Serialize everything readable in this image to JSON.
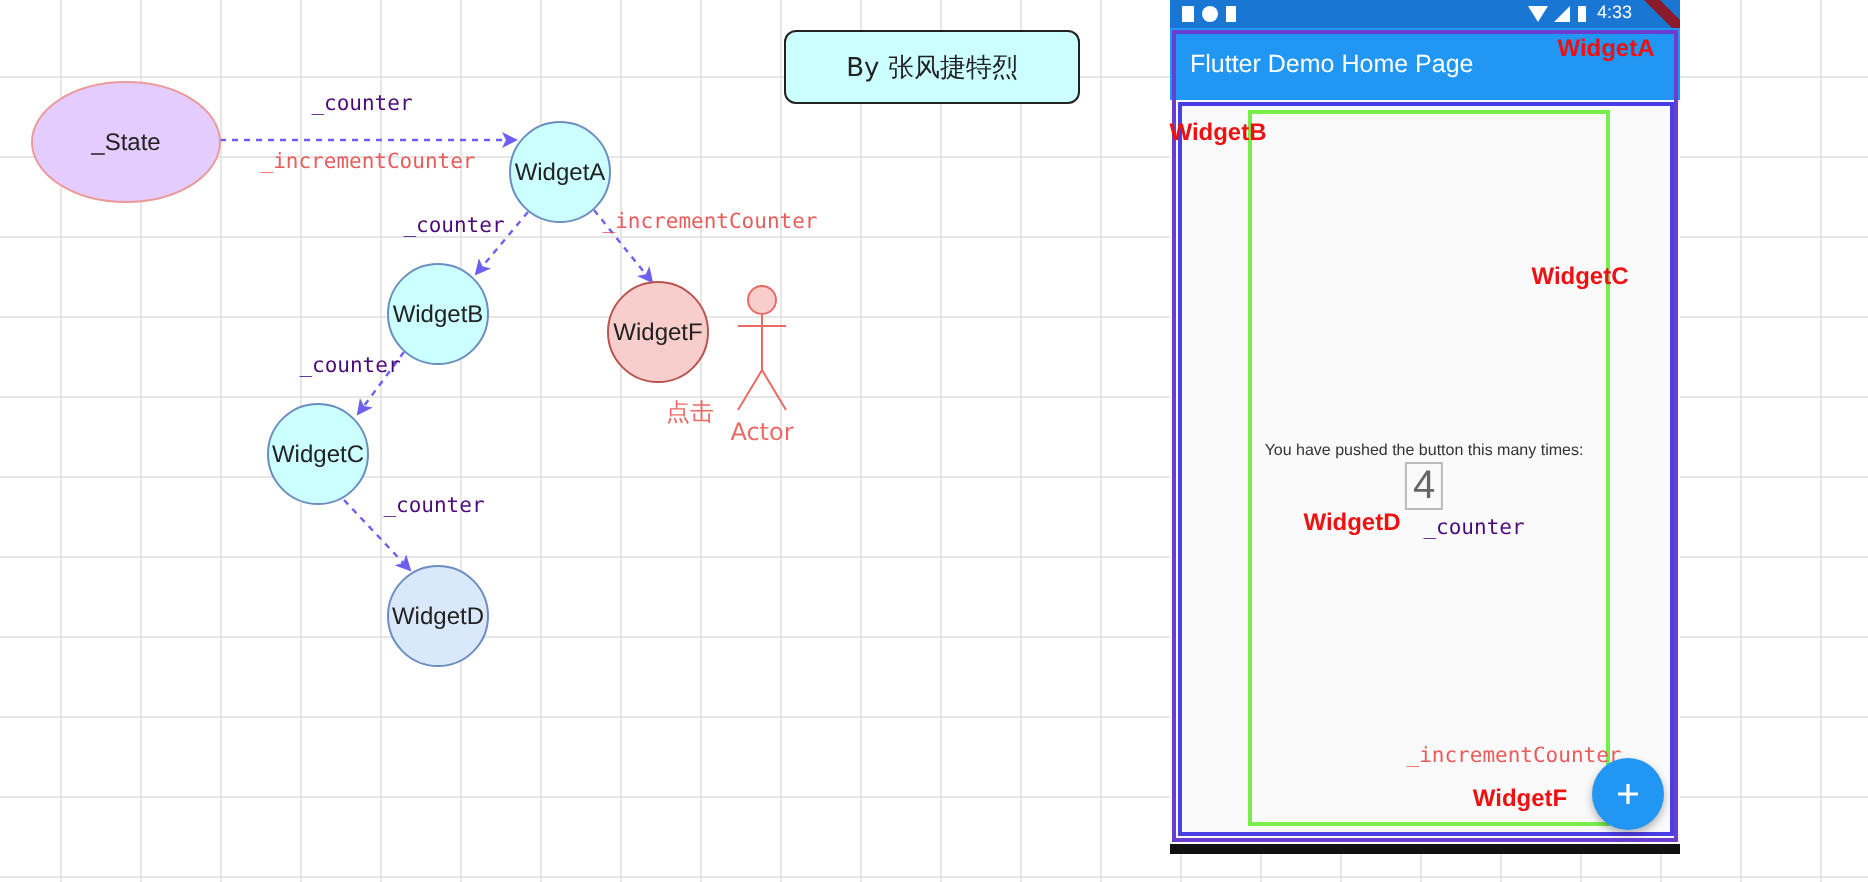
{
  "credit": {
    "text": "By 张风捷特烈"
  },
  "diagram": {
    "nodes": [
      {
        "label": "_State",
        "kind": "state"
      },
      {
        "label": "WidgetA",
        "kind": "widget"
      },
      {
        "label": "WidgetB",
        "kind": "widget"
      },
      {
        "label": "WidgetC",
        "kind": "widget"
      },
      {
        "label": "WidgetD",
        "kind": "leaf"
      },
      {
        "label": "WidgetF",
        "kind": "tapped"
      }
    ],
    "edges": [
      {
        "labels": [
          {
            "text": "_counter",
            "kind": "data"
          },
          {
            "text": "_incrementCounter",
            "kind": "callback"
          }
        ]
      },
      {
        "labels": [
          {
            "text": "_counter",
            "kind": "data"
          }
        ]
      },
      {
        "labels": [
          {
            "text": "_incrementCounter",
            "kind": "callback"
          }
        ]
      },
      {
        "labels": [
          {
            "text": "_counter",
            "kind": "data"
          }
        ]
      },
      {
        "labels": [
          {
            "text": "_counter",
            "kind": "data"
          }
        ]
      }
    ],
    "actor": {
      "label": "Actor",
      "action": "点击"
    }
  },
  "phone": {
    "status_time": "4:33",
    "app_title": "Flutter Demo Home Page",
    "message": "You have pushed the button this many times:",
    "count": "4",
    "annotations": [
      {
        "text": "WidgetA",
        "kind": "widget"
      },
      {
        "text": "WidgetB",
        "kind": "widget"
      },
      {
        "text": "WidgetC",
        "kind": "widget"
      },
      {
        "text": "WidgetD",
        "kind": "widget"
      },
      {
        "text": "_counter",
        "kind": "data"
      },
      {
        "text": "_incrementCounter",
        "kind": "callback"
      },
      {
        "text": "WidgetF",
        "kind": "widget"
      }
    ]
  }
}
